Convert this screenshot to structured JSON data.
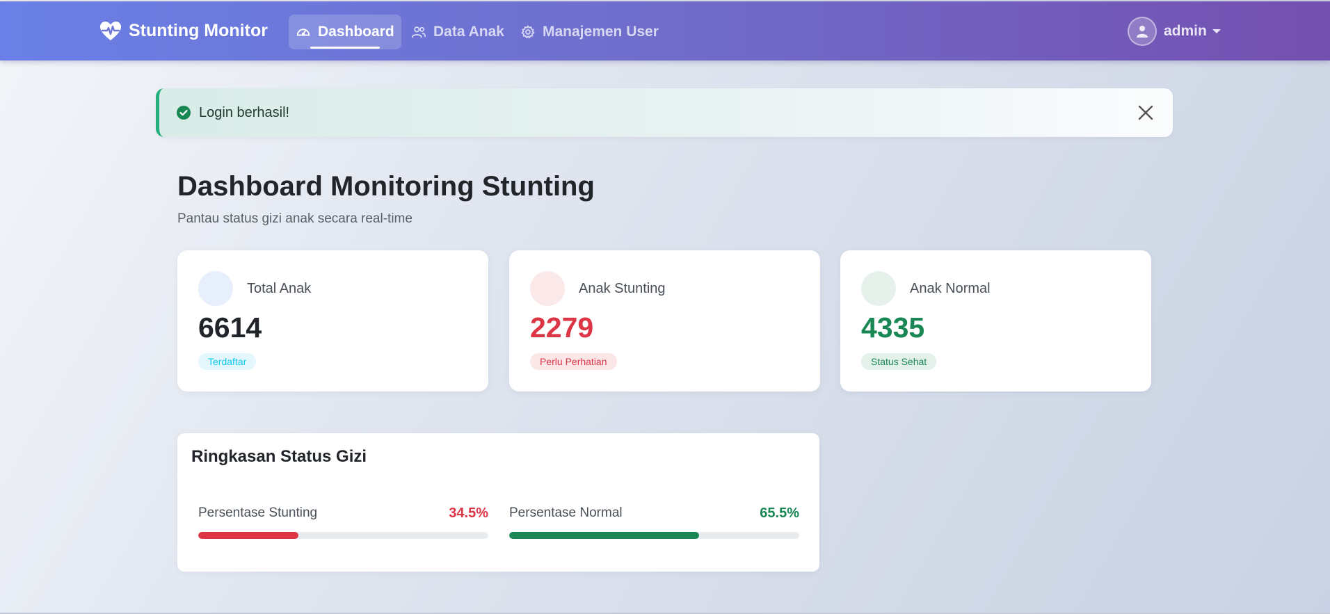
{
  "nav": {
    "brand": "Stunting Monitor",
    "items": [
      {
        "label": "Dashboard",
        "icon": "speedometer-icon",
        "active": true
      },
      {
        "label": "Data Anak",
        "icon": "people-icon",
        "active": false
      },
      {
        "label": "Manajemen User",
        "icon": "gear-icon",
        "active": false
      }
    ],
    "user": "admin"
  },
  "alert": {
    "message": "Login berhasil!",
    "color": "#23b07d"
  },
  "header": {
    "title": "Dashboard Monitoring Stunting",
    "subtitle": "Pantau status gizi anak secara real-time"
  },
  "cards": [
    {
      "label": "Total Anak",
      "value": "6614",
      "badge": "Terdaftar",
      "color": "#212529",
      "badge_color": "#0dcaf0",
      "badge_bg": "#e3f7fc",
      "circle_bg": "#e7effd"
    },
    {
      "label": "Anak Stunting",
      "value": "2279",
      "badge": "Perlu Perhatian",
      "color": "#dc3545",
      "badge_color": "#dc3545",
      "badge_bg": "#fbe6e8",
      "circle_bg": "#fbe9ea"
    },
    {
      "label": "Anak Normal",
      "value": "4335",
      "badge": "Status Sehat",
      "color": "#198754",
      "badge_color": "#198754",
      "badge_bg": "#e3f1ea",
      "circle_bg": "#e7f1eb"
    }
  ],
  "summary": {
    "title": "Ringkasan Status Gizi",
    "metrics": [
      {
        "label": "Persentase Stunting",
        "value": "34.5%",
        "fraction": 0.345,
        "color": "#dc3545"
      },
      {
        "label": "Persentase Normal",
        "value": "65.5%",
        "fraction": 0.655,
        "color": "#198754"
      }
    ]
  }
}
